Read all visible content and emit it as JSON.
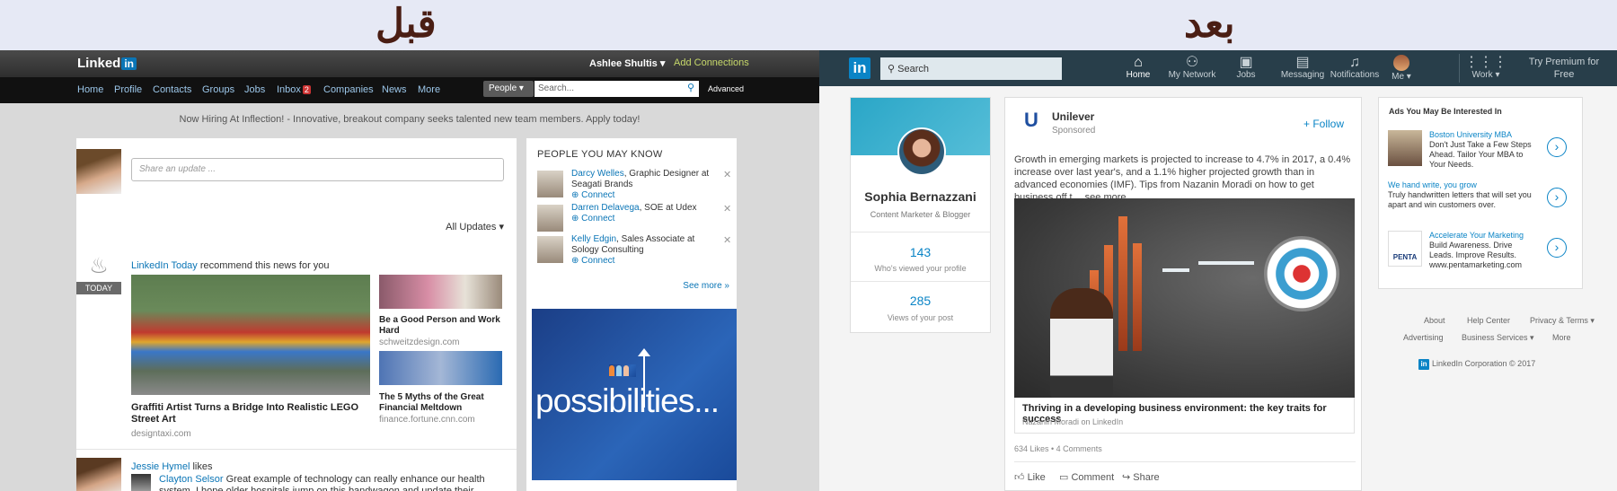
{
  "headings": {
    "before": "قبل",
    "after": "بعد"
  },
  "old": {
    "logo": "Linked",
    "logo_in": "in",
    "user": "Ashlee Shultis ▾",
    "add_connections": "Add Connections",
    "nav": [
      "Home",
      "Profile",
      "Contacts",
      "Groups",
      "Jobs",
      "Inbox",
      "Companies",
      "News",
      "More"
    ],
    "inbox_count": "2",
    "people_select": "People ▾",
    "search_placeholder": "Search...",
    "advanced": "Advanced",
    "hiring": "Now Hiring At Inflection! - Innovative, breakout company seeks talented new team members. Apply today!",
    "share_placeholder": "Share an update ...",
    "filter": "All Updates ▾",
    "today_badge": "TODAY",
    "rec_source": "LinkedIn Today",
    "rec_text": " recommend this news for you",
    "articles": [
      {
        "title": "Graffiti Artist Turns a Bridge Into Realistic LEGO Street Art",
        "source": "designtaxi.com"
      },
      {
        "title": "Be a Good Person and Work Hard",
        "source": "schweitzdesign.com"
      },
      {
        "title": "The 5 Myths of the Great Financial Meltdown",
        "source": "finance.fortune.cnn.com"
      }
    ],
    "activity": {
      "name": "Jessie Hymel",
      "verb": " likes",
      "actor": "Clayton Selsor",
      "text": " Great example of technology can really enhance our health system.  I hope older hospitals jump on this bandwagon and update their centers."
    },
    "pymk_title": "PEOPLE YOU MAY KNOW",
    "pymk": [
      {
        "name": "Darcy Welles",
        "role": ", Graphic Designer at Seagati Brands",
        "connect": "Connect"
      },
      {
        "name": "Darren Delavega",
        "role": ", SOE at Udex",
        "connect": "Connect"
      },
      {
        "name": "Kelly Edgin",
        "role": ", Sales Associate at Sology Consulting",
        "connect": "Connect"
      }
    ],
    "see_more": "See more »",
    "ad_word": "possibilities...",
    "colors": {
      "link": "#0a75b6",
      "topbar": "#2e2e2e",
      "addconn": "#c6d86a"
    }
  },
  "new": {
    "search_placeholder": "Search",
    "nav": [
      {
        "label": "Home",
        "icon": "home-icon"
      },
      {
        "label": "My Network",
        "icon": "network-icon"
      },
      {
        "label": "Jobs",
        "icon": "briefcase-icon"
      },
      {
        "label": "Messaging",
        "icon": "messaging-icon"
      },
      {
        "label": "Notifications",
        "icon": "bell-icon"
      },
      {
        "label": "Me ▾",
        "icon": "avatar"
      },
      {
        "label": "Work ▾",
        "icon": "grid-icon"
      }
    ],
    "premium": "Try Premium for Free",
    "profile": {
      "name": "Sophia Bernazzani",
      "role": "Content Marketer & Blogger",
      "views": "143",
      "views_label": "Who's viewed your profile",
      "post_views": "285",
      "post_views_label": "Views of your post"
    },
    "post": {
      "brand": "Unilever",
      "sponsored": "Sponsored",
      "follow": "+ Follow",
      "text": "Growth in emerging markets is projected to increase to 4.7% in 2017, a 0.4% increase over last year's, and a 1.1% higher projected growth than in advanced economies (IMF). Tips from Nazanin Moradi on how to get business off t  …see more",
      "caption_title": "Thriving in a developing business environment: the key traits for success",
      "caption_source": "Nazanin Moradi on LinkedIn",
      "stats": "634 Likes • 4 Comments",
      "actions": [
        "Like",
        "Comment",
        "Share"
      ]
    },
    "ads_title": "Ads You May Be Interested In",
    "ads": [
      {
        "title": "Boston University MBA",
        "text": "Don't Just Take a Few Steps Ahead. Tailor Your MBA to Your Needs."
      },
      {
        "title": "We hand write, you grow",
        "text": "Truly handwritten letters that will set you apart and win customers over."
      },
      {
        "title": "Accelerate Your Marketing",
        "text": "Build Awareness. Drive Leads. Improve Results. www.pentamarketing.com"
      }
    ],
    "ad_brand": "PENTA",
    "footer": [
      "About",
      "Help Center",
      "Privacy & Terms ▾",
      "Advertising",
      "Business Services ▾",
      "More"
    ],
    "corp": "LinkedIn Corporation © 2017",
    "colors": {
      "topbar": "#283e4a",
      "accent": "#0a84c6"
    }
  }
}
